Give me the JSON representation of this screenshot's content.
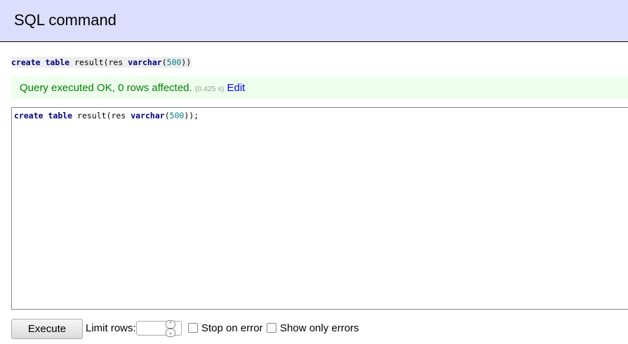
{
  "header": {
    "title": "SQL command"
  },
  "executed_query": {
    "kw_create": "create",
    "kw_table": "table",
    "name": "result(res",
    "kw_type": "varchar",
    "open": "(",
    "number": "500",
    "close": "))"
  },
  "message": {
    "text": "Query executed OK, 0 rows affected.",
    "time": "(0.425 s)",
    "edit_label": "Edit"
  },
  "editor": {
    "kw_create": "create",
    "kw_table": "table",
    "name": "result(res",
    "kw_type": "varchar",
    "open": "(",
    "number": "500",
    "close": "));"
  },
  "footer": {
    "execute_label": "Execute",
    "limit_label": "Limit rows:",
    "limit_value": "",
    "stop_on_error_label": "Stop on error",
    "show_only_errors_label": "Show only errors"
  },
  "colors": {
    "header_bg": "#ddddfd",
    "message_bg": "#eeffee",
    "message_text": "#008000",
    "keyword": "#000080",
    "number": "#008080",
    "link": "#0000ee"
  }
}
